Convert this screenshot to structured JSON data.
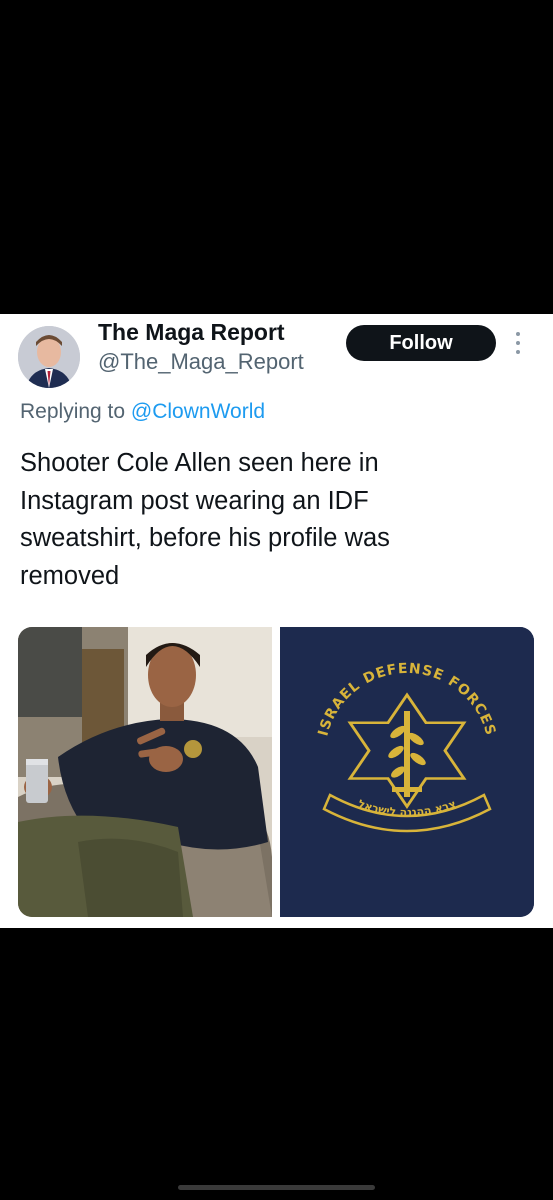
{
  "post": {
    "display_name": "The Maga Report",
    "handle": "@The_Maga_Report",
    "follow_label": "Follow",
    "more_icon": "more-vertical-icon",
    "replying_prefix": "Replying to",
    "replying_handle": "@ClownWorld",
    "text_lines": [
      "Shooter Cole Allen seen here in",
      "Instagram post wearing an IDF",
      "sweatshirt, before his profile was",
      "removed"
    ]
  },
  "media": {
    "emblem_top_text": "ISRAEL DEFENSE FORCES",
    "emblem_bottom_text": "צבא ההגנה לישראל"
  },
  "colors": {
    "link": "#1d9bf0",
    "follow_bg": "#0f1419",
    "secondary_text": "#536471",
    "emblem_gold": "#d8b43a",
    "shirt_navy": "#1d2a4e"
  }
}
